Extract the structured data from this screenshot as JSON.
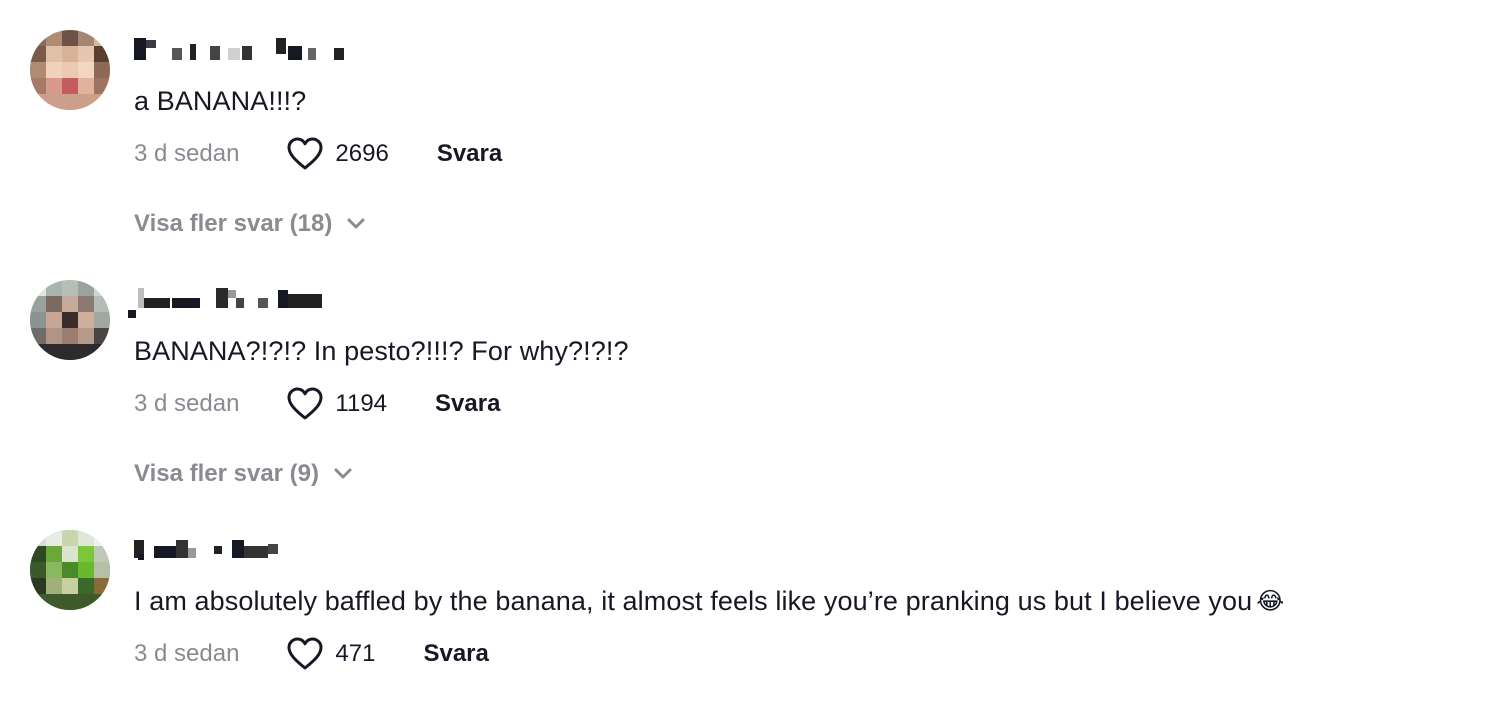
{
  "comments": [
    {
      "text": "a BANANA!!!?",
      "time": "3 d sedan",
      "likes": "2696",
      "reply_label": "Svara",
      "more_replies": "Visa fler svar (18)",
      "avatar_colors": [
        "#a27e6a",
        "#d0a48a",
        "#7a5544",
        "#c65a62",
        "#e6c2a8"
      ]
    },
    {
      "text": "BANANA?!?!? In pesto?!!!? For why?!?!?",
      "time": "3 d sedan",
      "likes": "1194",
      "reply_label": "Svara",
      "more_replies": "Visa fler svar (9)",
      "avatar_colors": [
        "#9aa19c",
        "#b8a093",
        "#5c4a44",
        "#2c2a2c",
        "#d6d2cf"
      ]
    },
    {
      "text": "I am absolutely baffled by the banana, it almost feels like you’re pranking us but I believe you",
      "emoji": "😂",
      "time": "3 d sedan",
      "likes": "471",
      "reply_label": "Svara",
      "avatar_colors": [
        "#4a8a2a",
        "#7cc63a",
        "#2e4a22",
        "#8a6a3a",
        "#c8d6b0"
      ]
    }
  ],
  "icons": {
    "like": "heart-outline-icon",
    "expand": "chevron-down-icon"
  },
  "colors": {
    "text": "#161823",
    "muted": "#8a8b91",
    "background": "#ffffff"
  }
}
